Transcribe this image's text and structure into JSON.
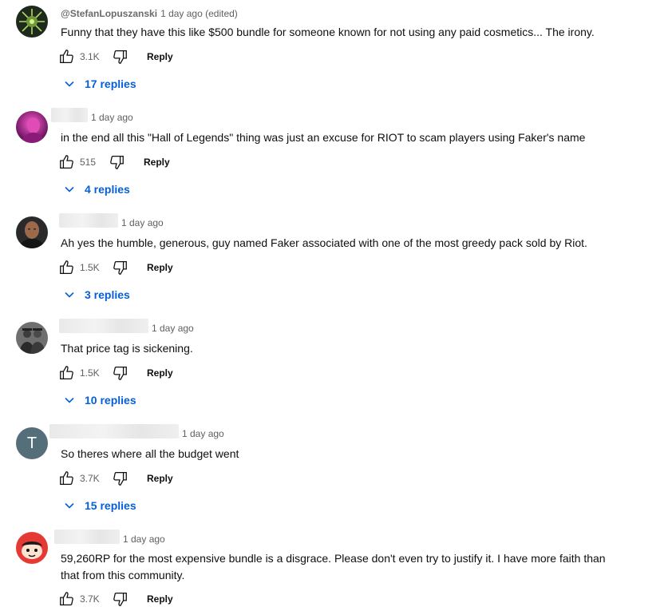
{
  "colors": {
    "link": "#065fd4",
    "meta": "#606060",
    "text": "#0f0f0f"
  },
  "comments": [
    {
      "author": "@StefanLopuszanski",
      "timestamp": "1 day ago (edited)",
      "text": "Funny that they have this like $500 bundle for someone known for not using any paid cosmetics... The irony.",
      "likes": "3.1K",
      "reply_label": "Reply",
      "replies": "17 replies",
      "avatar": "green-emblem-avatar"
    },
    {
      "author": "",
      "timestamp": "1 day ago",
      "text": "in the end all this \"Hall of Legends\" thing was just an excuse for RIOT to scam players using Faker's name",
      "likes": "515",
      "reply_label": "Reply",
      "replies": "4 replies",
      "avatar": "magenta-portrait-avatar"
    },
    {
      "author": "",
      "timestamp": "1 day ago",
      "text": "Ah yes the humble, generous, guy named Faker associated with one of the most greedy pack sold by Riot.",
      "likes": "1.5K",
      "reply_label": "Reply",
      "replies": "3 replies",
      "avatar": "bald-man-avatar"
    },
    {
      "author": "",
      "timestamp": "1 day ago",
      "text": "That price tag is sickening.",
      "likes": "1.5K",
      "reply_label": "Reply",
      "replies": "10 replies",
      "avatar": "two-men-avatar"
    },
    {
      "author": "",
      "timestamp": "1 day ago",
      "text": "So theres where all the budget went",
      "likes": "3.7K",
      "reply_label": "Reply",
      "replies": "15 replies",
      "avatar": "letter-avatar",
      "avatar_letter": "T"
    },
    {
      "author": "",
      "timestamp": "1 day ago",
      "text": "59,260RP for the most expensive bundle is a disgrace. Please don't even try to justify it. I have more faith than that from this community.",
      "likes": "3.7K",
      "reply_label": "Reply",
      "replies": "",
      "avatar": "cartoon-face-avatar"
    }
  ]
}
